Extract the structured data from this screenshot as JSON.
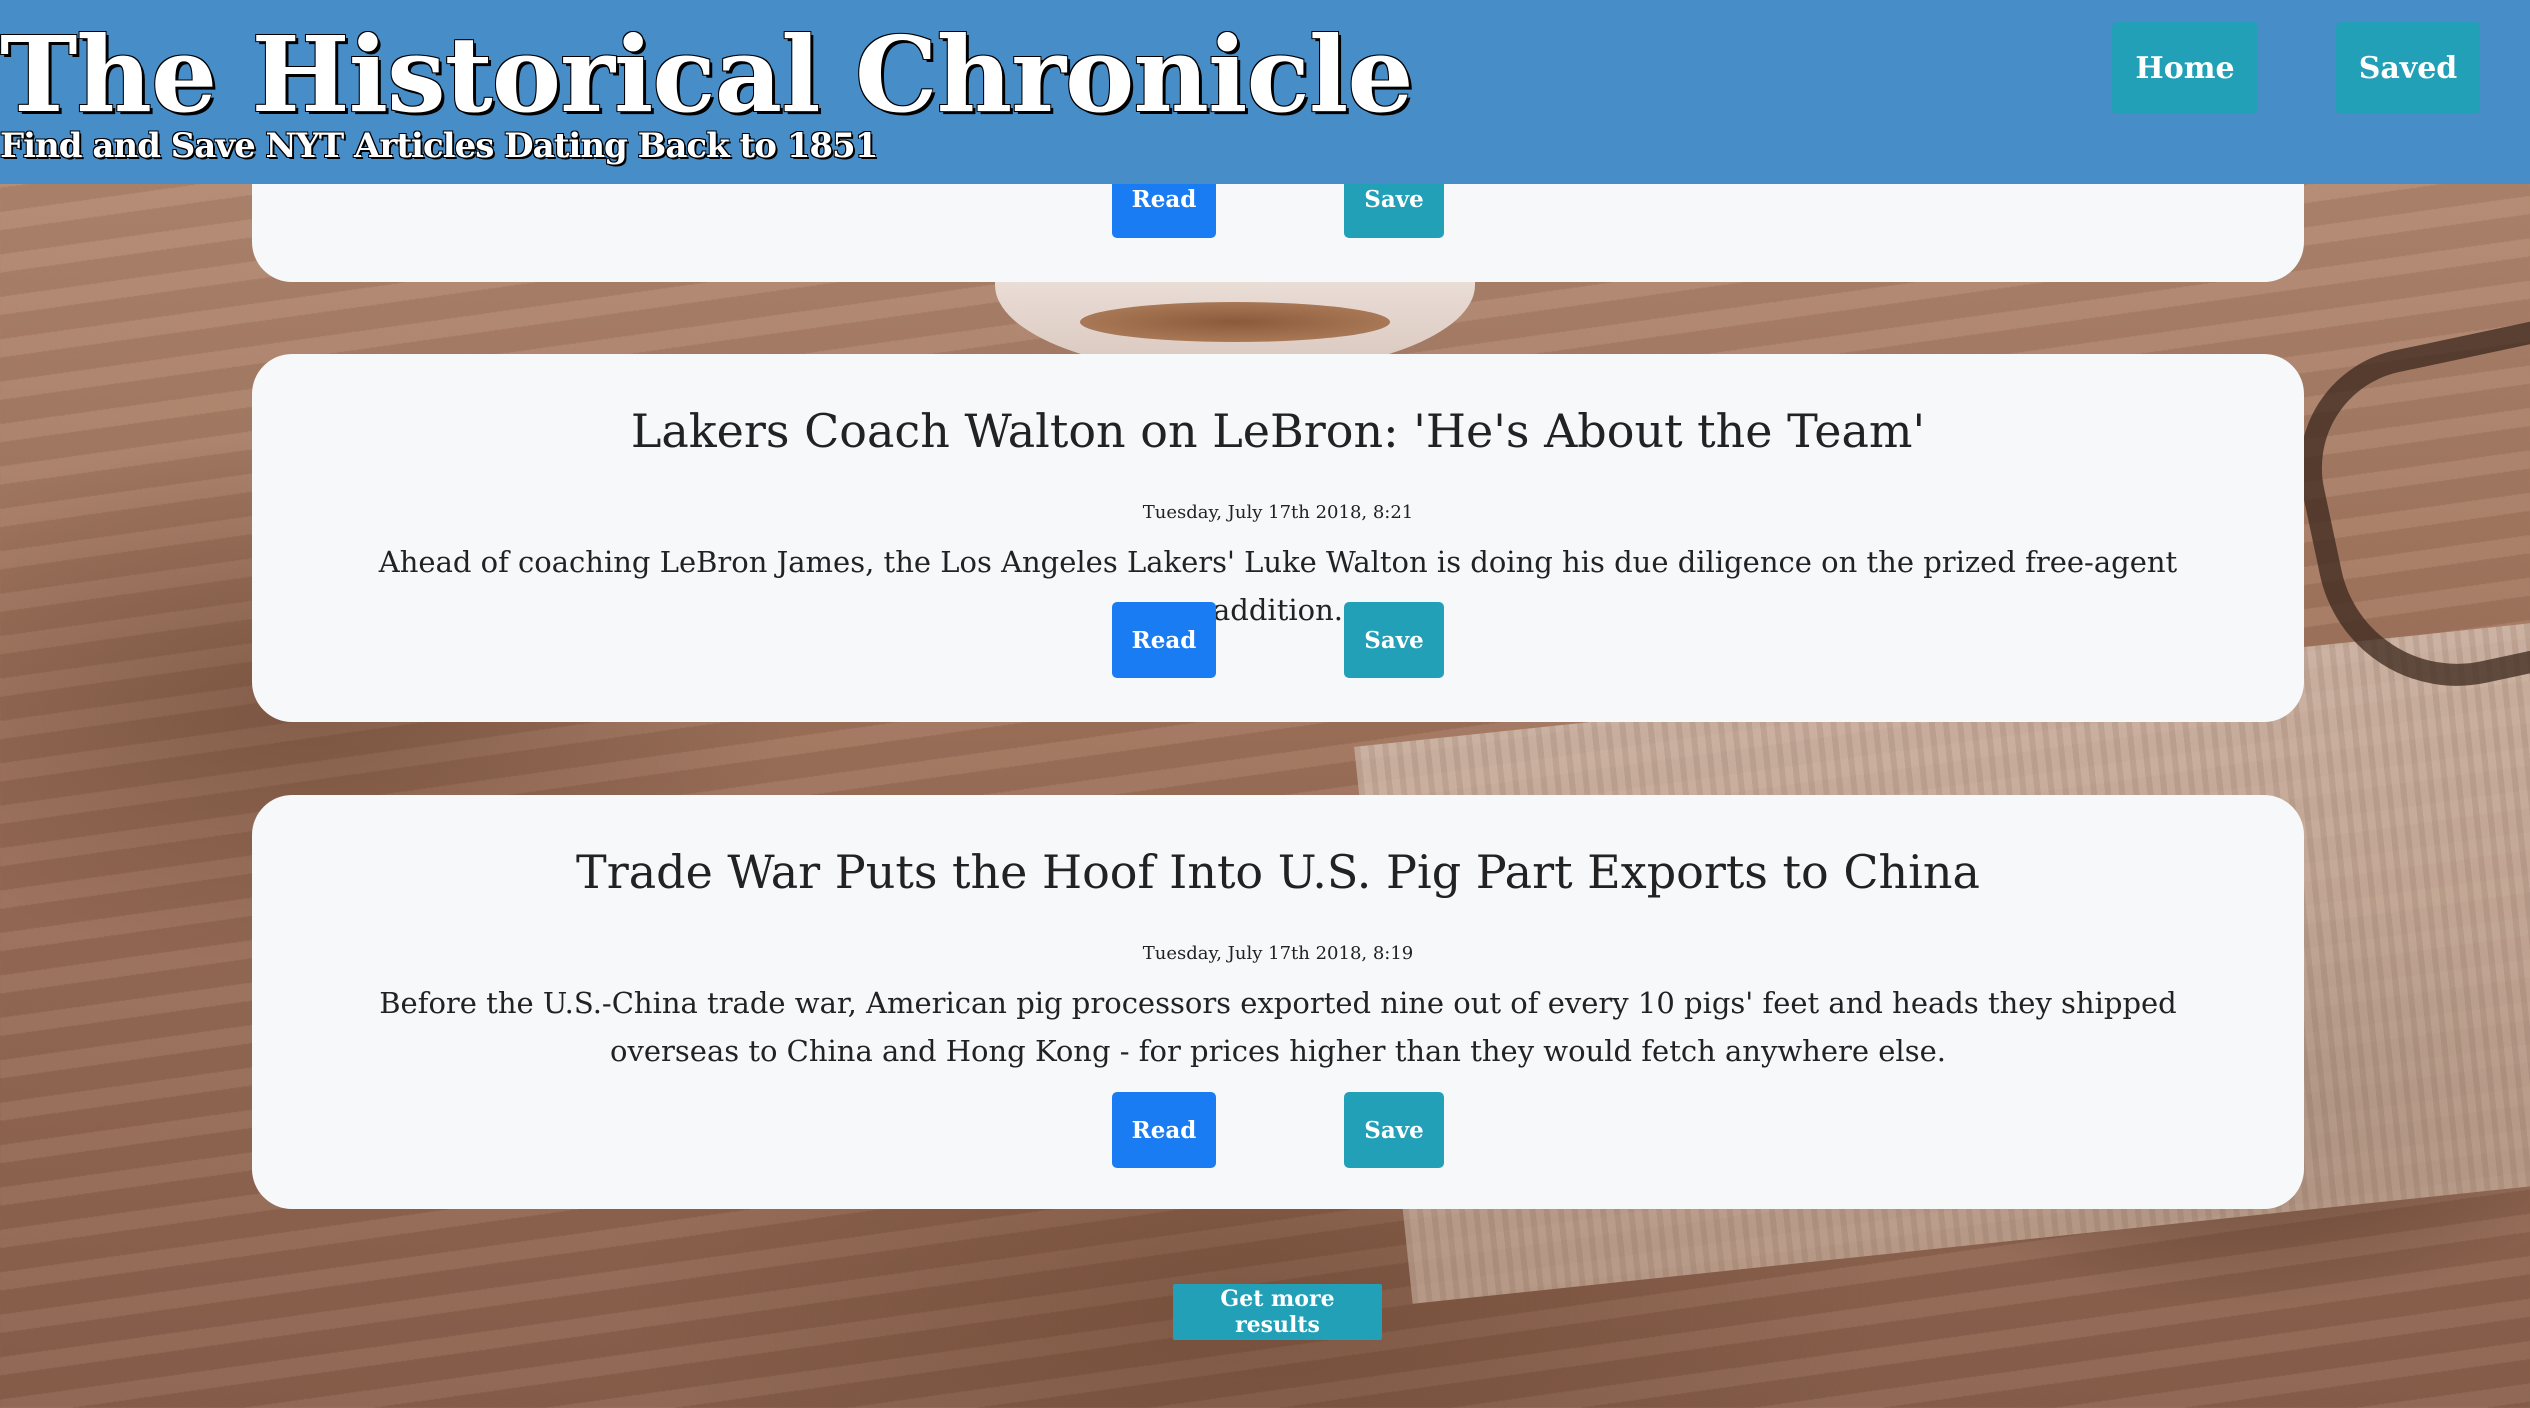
{
  "header": {
    "title": "The Historical Chronicle",
    "subtitle": "Find and Save NYT Articles Dating Back to 1851",
    "nav": {
      "home_label": "Home",
      "saved_label": "Saved"
    },
    "background_color": "#478dc8"
  },
  "articles": [
    {
      "read_label": "Read",
      "save_label": "Save"
    },
    {
      "title": "Lakers Coach Walton on LeBron: 'He's About the Team'",
      "date": "Tuesday, July 17th 2018, 8:21",
      "summary": "Ahead of coaching LeBron James, the Los Angeles Lakers' Luke Walton is doing his due diligence on the prized free-agent addition.",
      "read_label": "Read",
      "save_label": "Save"
    },
    {
      "title": "Trade War Puts the Hoof Into U.S. Pig Part Exports to China",
      "date": "Tuesday, July 17th 2018, 8:19",
      "summary": "Before the U.S.-China trade war, American pig processors exported nine out of every 10 pigs' feet and heads they shipped overseas to China and Hong Kong - for prices higher than they would fetch anywhere else.",
      "read_label": "Read",
      "save_label": "Save"
    }
  ],
  "more_results_label": "Get more results",
  "colors": {
    "read_button": "#1a7cf2",
    "save_button": "#22a0b7",
    "card_background": "#f7f8fa"
  }
}
